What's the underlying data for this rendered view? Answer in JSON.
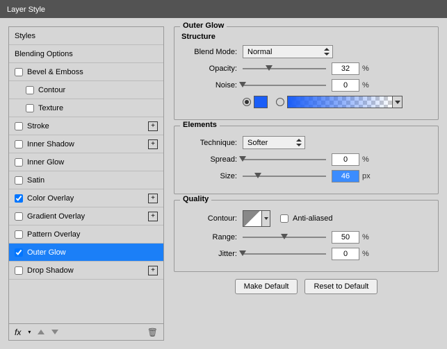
{
  "window": {
    "title": "Layer Style"
  },
  "sidebar": {
    "header": "Styles",
    "items": [
      {
        "label": "Blending Options",
        "checkbox": false,
        "indent": 0,
        "plus": false
      },
      {
        "label": "Bevel & Emboss",
        "checkbox": true,
        "checked": false,
        "indent": 0,
        "plus": false
      },
      {
        "label": "Contour",
        "checkbox": true,
        "checked": false,
        "indent": 1,
        "plus": false
      },
      {
        "label": "Texture",
        "checkbox": true,
        "checked": false,
        "indent": 1,
        "plus": false
      },
      {
        "label": "Stroke",
        "checkbox": true,
        "checked": false,
        "indent": 0,
        "plus": true
      },
      {
        "label": "Inner Shadow",
        "checkbox": true,
        "checked": false,
        "indent": 0,
        "plus": true
      },
      {
        "label": "Inner Glow",
        "checkbox": true,
        "checked": false,
        "indent": 0,
        "plus": false
      },
      {
        "label": "Satin",
        "checkbox": true,
        "checked": false,
        "indent": 0,
        "plus": false
      },
      {
        "label": "Color Overlay",
        "checkbox": true,
        "checked": true,
        "indent": 0,
        "plus": true
      },
      {
        "label": "Gradient Overlay",
        "checkbox": true,
        "checked": false,
        "indent": 0,
        "plus": true
      },
      {
        "label": "Pattern Overlay",
        "checkbox": true,
        "checked": false,
        "indent": 0,
        "plus": false
      },
      {
        "label": "Outer Glow",
        "checkbox": true,
        "checked": true,
        "indent": 0,
        "plus": false,
        "selected": true
      },
      {
        "label": "Drop Shadow",
        "checkbox": true,
        "checked": false,
        "indent": 0,
        "plus": true
      }
    ],
    "footer": {
      "fx": "fx"
    }
  },
  "panel": {
    "title": "Outer Glow",
    "structure": {
      "heading": "Structure",
      "blendMode": {
        "label": "Blend Mode:",
        "value": "Normal"
      },
      "opacity": {
        "label": "Opacity:",
        "value": "32",
        "unit": "%",
        "pos": 32
      },
      "noise": {
        "label": "Noise:",
        "value": "0",
        "unit": "%",
        "pos": 0
      },
      "color": "#1b5ef7"
    },
    "elements": {
      "heading": "Elements",
      "technique": {
        "label": "Technique:",
        "value": "Softer"
      },
      "spread": {
        "label": "Spread:",
        "value": "0",
        "unit": "%",
        "pos": 0
      },
      "size": {
        "label": "Size:",
        "value": "46",
        "unit": "px",
        "pos": 18
      }
    },
    "quality": {
      "heading": "Quality",
      "contour": {
        "label": "Contour:"
      },
      "antialias": {
        "label": "Anti-aliased",
        "checked": false
      },
      "range": {
        "label": "Range:",
        "value": "50",
        "unit": "%",
        "pos": 50
      },
      "jitter": {
        "label": "Jitter:",
        "value": "0",
        "unit": "%",
        "pos": 0
      }
    },
    "buttons": {
      "makeDefault": "Make Default",
      "resetDefault": "Reset to Default"
    }
  }
}
